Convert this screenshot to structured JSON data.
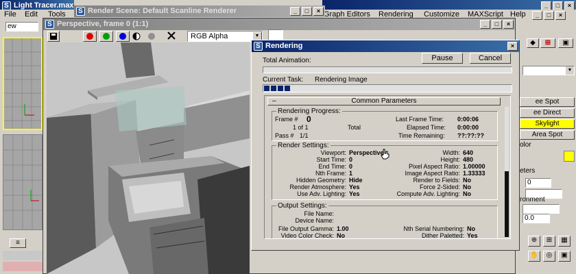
{
  "main_window": {
    "title": "Light Tracer.max",
    "menu": [
      "File",
      "Edit",
      "Tools",
      "Graph Editors",
      "Rendering",
      "Customize",
      "MAXScript",
      "Help"
    ],
    "left_field": "ew"
  },
  "render_scene": {
    "title": "Render Scene: Default Scanline Renderer"
  },
  "frame_window": {
    "title": "Perspective, frame 0 (1:1)",
    "channel": "RGB Alpha"
  },
  "right_panel": {
    "items": [
      "ee Spot",
      "ee Direct",
      "Skylight",
      "Area Spot"
    ],
    "section1": "olor",
    "section2": "eters",
    "spinner_value": "0",
    "section3": "ronment",
    "spinner2_value": "0.0"
  },
  "rendering": {
    "title": "Rendering",
    "pause_label": "Pause",
    "cancel_label": "Cancel",
    "total_animation_label": "Total Animation:",
    "current_task_label": "Current Task:",
    "current_task_value": "Rendering Image",
    "rollout_title": "Common Parameters",
    "rollout_toggle": "–",
    "progress_group": "Rendering Progress:",
    "frame_label": "Frame #",
    "frame_value": "0",
    "of_value": "1 of 1",
    "total_label": "Total",
    "pass_label": "Pass #",
    "pass_value": "1/1",
    "last_frame_time_label": "Last Frame Time:",
    "last_frame_time_value": "0:00:06",
    "elapsed_time_label": "Elapsed Time:",
    "elapsed_time_value": "0:00:00",
    "time_remaining_label": "Time Remaining:",
    "time_remaining_value": "??:??:??",
    "render_settings_group": "Render Settings:",
    "settings_left": [
      {
        "label": "Viewport:",
        "value": "Perspective"
      },
      {
        "label": "Start Time:",
        "value": "0"
      },
      {
        "label": "End Time:",
        "value": "0"
      },
      {
        "label": "Nth Frame:",
        "value": "1"
      },
      {
        "label": "Hidden Geometry:",
        "value": "Hide"
      },
      {
        "label": "Render Atmosphere:",
        "value": "Yes"
      },
      {
        "label": "Use Adv. Lighting:",
        "value": "Yes"
      }
    ],
    "settings_right": [
      {
        "label": "Width:",
        "value": "640"
      },
      {
        "label": "Height:",
        "value": "480"
      },
      {
        "label": "Pixel Aspect Ratio:",
        "value": "1.00000"
      },
      {
        "label": "Image Aspect Ratio:",
        "value": "1.33333"
      },
      {
        "label": "Render to Fields:",
        "value": "No"
      },
      {
        "label": "Force 2-Sided:",
        "value": "No"
      },
      {
        "label": "Compute Adv. Lighting:",
        "value": "No"
      }
    ],
    "output_group": "Output Settings:",
    "file_name_label": "File Name:",
    "device_name_label": "Device Name:",
    "gamma_label": "File Output Gamma:",
    "gamma_value": "1.00",
    "serial_label": "Nth Serial Numbering:",
    "serial_value": "No",
    "video_check_label": "Video Color Check:",
    "video_check_value": "No",
    "dither_label": "Dither Paletted:",
    "dither_value": "Yes",
    "current_task_progress": 0.08,
    "total_animation_progress": 0
  },
  "colors": {
    "title_active": "#0a246a",
    "progress_fill": "#0a246a",
    "highlight": "#ffff00"
  }
}
